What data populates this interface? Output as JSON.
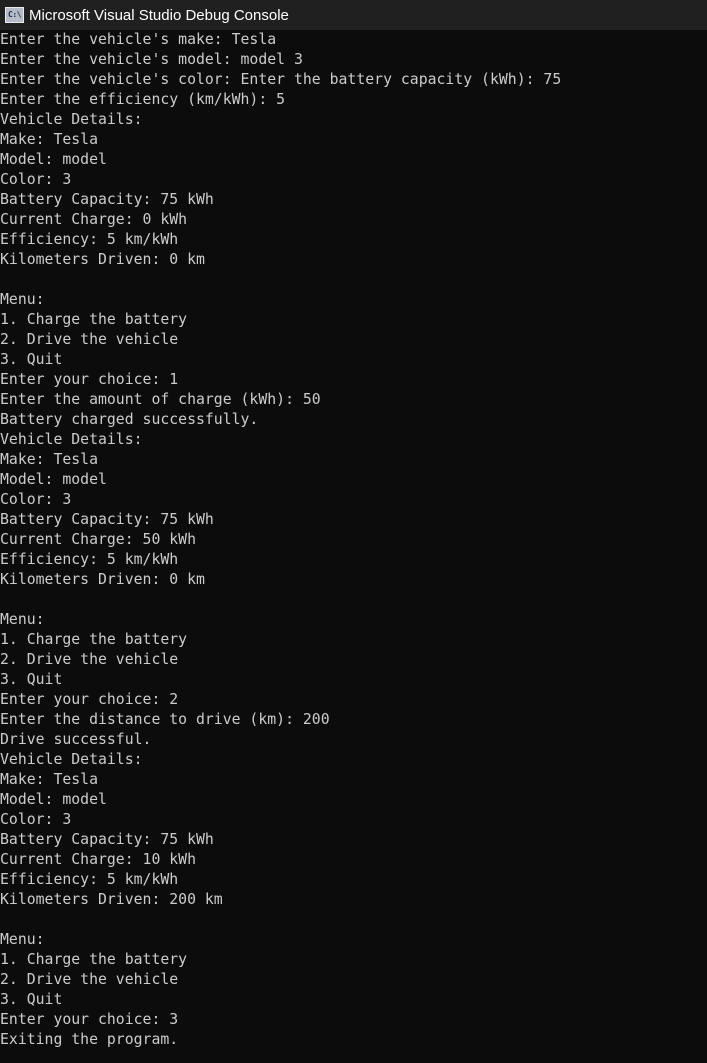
{
  "window": {
    "title": "Microsoft Visual Studio Debug Console",
    "icon": "console-app-icon",
    "icon_text": "C:\\",
    "colors": {
      "titlebar": "#202020",
      "background": "#0c0c0c",
      "text": "#cccccc"
    }
  },
  "console": {
    "lines": [
      "Enter the vehicle's make: Tesla",
      "Enter the vehicle's model: model 3",
      "Enter the vehicle's color: Enter the battery capacity (kWh): 75",
      "Enter the efficiency (km/kWh): 5",
      "Vehicle Details:",
      "Make: Tesla",
      "Model: model",
      "Color: 3",
      "Battery Capacity: 75 kWh",
      "Current Charge: 0 kWh",
      "Efficiency: 5 km/kWh",
      "Kilometers Driven: 0 km",
      "",
      "Menu:",
      "1. Charge the battery",
      "2. Drive the vehicle",
      "3. Quit",
      "Enter your choice: 1",
      "Enter the amount of charge (kWh): 50",
      "Battery charged successfully.",
      "Vehicle Details:",
      "Make: Tesla",
      "Model: model",
      "Color: 3",
      "Battery Capacity: 75 kWh",
      "Current Charge: 50 kWh",
      "Efficiency: 5 km/kWh",
      "Kilometers Driven: 0 km",
      "",
      "Menu:",
      "1. Charge the battery",
      "2. Drive the vehicle",
      "3. Quit",
      "Enter your choice: 2",
      "Enter the distance to drive (km): 200",
      "Drive successful.",
      "Vehicle Details:",
      "Make: Tesla",
      "Model: model",
      "Color: 3",
      "Battery Capacity: 75 kWh",
      "Current Charge: 10 kWh",
      "Efficiency: 5 km/kWh",
      "Kilometers Driven: 200 km",
      "",
      "Menu:",
      "1. Charge the battery",
      "2. Drive the vehicle",
      "3. Quit",
      "Enter your choice: 3",
      "Exiting the program."
    ]
  }
}
